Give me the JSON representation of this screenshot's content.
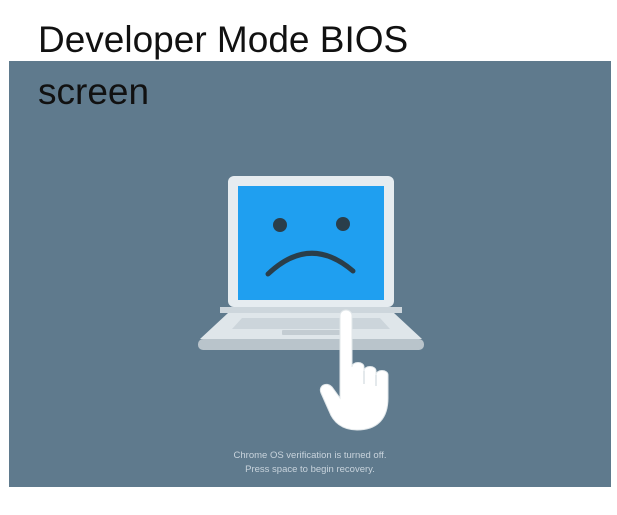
{
  "slide": {
    "title": "Developer Mode BIOS screen"
  },
  "screen": {
    "background_color": "#5f7a8d",
    "illustration": {
      "laptop_icon": "sad-laptop-icon",
      "hand_icon": "pointing-hand-icon",
      "display_color": "#1f9ff0"
    },
    "message": {
      "line1": "Chrome OS verification is turned off.",
      "line2": "Press space to begin recovery."
    }
  }
}
